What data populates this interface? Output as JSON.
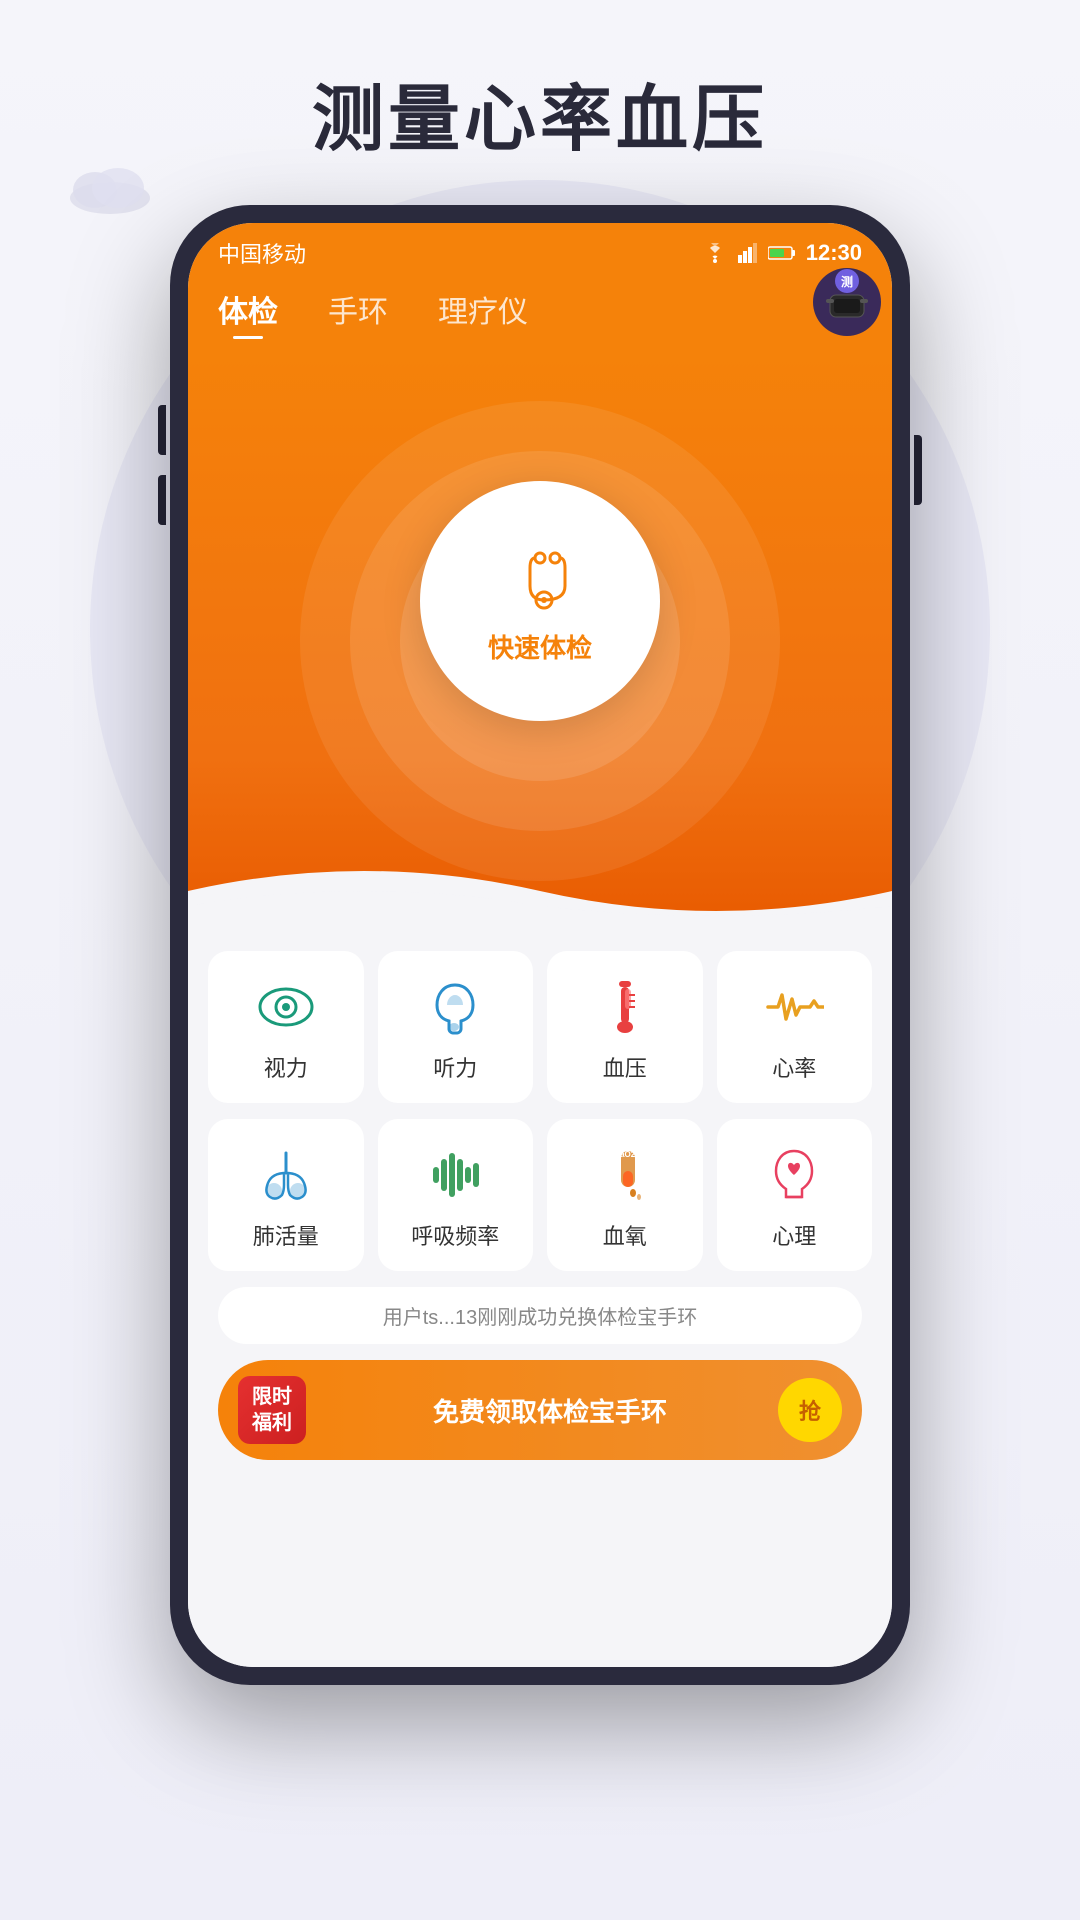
{
  "page": {
    "title": "测量心率血压",
    "background_color": "#f0f0f8"
  },
  "status_bar": {
    "carrier": "中国移动",
    "time": "12:30",
    "wifi_icon": "wifi",
    "signal_icon": "signal",
    "battery_icon": "battery"
  },
  "nav_tabs": [
    {
      "label": "体检",
      "active": true
    },
    {
      "label": "手环",
      "active": false
    },
    {
      "label": "理疗仪",
      "active": false
    }
  ],
  "hero": {
    "center_label": "快速体检",
    "wristband_badge_label": "测"
  },
  "grid_rows": [
    [
      {
        "label": "视力",
        "icon": "eye",
        "color": "#1a9a7a"
      },
      {
        "label": "听力",
        "icon": "ear",
        "color": "#2b8fcc"
      },
      {
        "label": "血压",
        "icon": "thermometer",
        "color": "#e84040"
      },
      {
        "label": "心率",
        "icon": "heartrate",
        "color": "#e8a020"
      }
    ],
    [
      {
        "label": "肺活量",
        "icon": "lungs",
        "color": "#2b8fcc"
      },
      {
        "label": "呼吸频率",
        "icon": "breath",
        "color": "#40a060"
      },
      {
        "label": "血氧",
        "icon": "blood_oxygen",
        "color": "#d88020"
      },
      {
        "label": "心理",
        "icon": "psychology",
        "color": "#e84060"
      }
    ]
  ],
  "notification": {
    "text": "用户ts...13刚刚成功兑换体检宝手环"
  },
  "banner": {
    "badge_line1": "限时",
    "badge_line2": "福利",
    "text": "免费领取体检宝手环",
    "button_label": "抢"
  }
}
